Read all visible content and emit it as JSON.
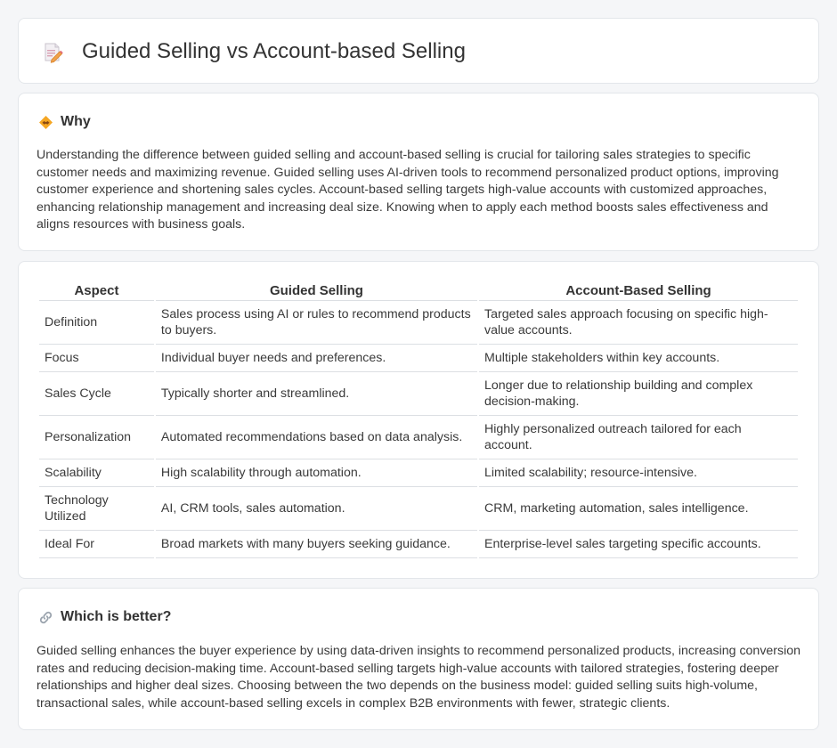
{
  "header": {
    "title": "Guided Selling vs Account-based Selling",
    "icon": "document-pencil-icon"
  },
  "why": {
    "title": "Why",
    "icon": "handshake-icon",
    "text": "Understanding the difference between guided selling and account-based selling is crucial for tailoring sales strategies to specific customer needs and maximizing revenue. Guided selling uses AI-driven tools to recommend personalized product options, improving customer experience and shortening sales cycles. Account-based selling targets high-value accounts with customized approaches, enhancing relationship management and increasing deal size. Knowing when to apply each method boosts sales effectiveness and aligns resources with business goals."
  },
  "comparison": {
    "headers": [
      "Aspect",
      "Guided Selling",
      "Account-Based Selling"
    ],
    "rows": [
      [
        "Definition",
        "Sales process using AI or rules to recommend products to buyers.",
        "Targeted sales approach focusing on specific high-value accounts."
      ],
      [
        "Focus",
        "Individual buyer needs and preferences.",
        "Multiple stakeholders within key accounts."
      ],
      [
        "Sales Cycle",
        "Typically shorter and streamlined.",
        "Longer due to relationship building and complex decision-making."
      ],
      [
        "Personalization",
        "Automated recommendations based on data analysis.",
        "Highly personalized outreach tailored for each account."
      ],
      [
        "Scalability",
        "High scalability through automation.",
        "Limited scalability; resource-intensive."
      ],
      [
        "Technology Utilized",
        "AI, CRM tools, sales automation.",
        "CRM, marketing automation, sales intelligence."
      ],
      [
        "Ideal For",
        "Broad markets with many buyers seeking guidance.",
        "Enterprise-level sales targeting specific accounts."
      ]
    ]
  },
  "which": {
    "title": "Which is better?",
    "icon": "link-icon",
    "text": "Guided selling enhances the buyer experience by using data-driven insights to recommend personalized products, increasing conversion rates and reducing decision-making time. Account-based selling targets high-value accounts with tailored strategies, fostering deeper relationships and higher deal sizes. Choosing between the two depends on the business model: guided selling suits high-volume, transactional sales, while account-based selling excels in complex B2B environments with fewer, strategic clients."
  },
  "colors": {
    "background": "#f5f6f8",
    "card": "#ffffff",
    "border": "#e3e6ea",
    "accent_orange": "#f39c3d",
    "icon_pink": "#e8a0b4"
  }
}
